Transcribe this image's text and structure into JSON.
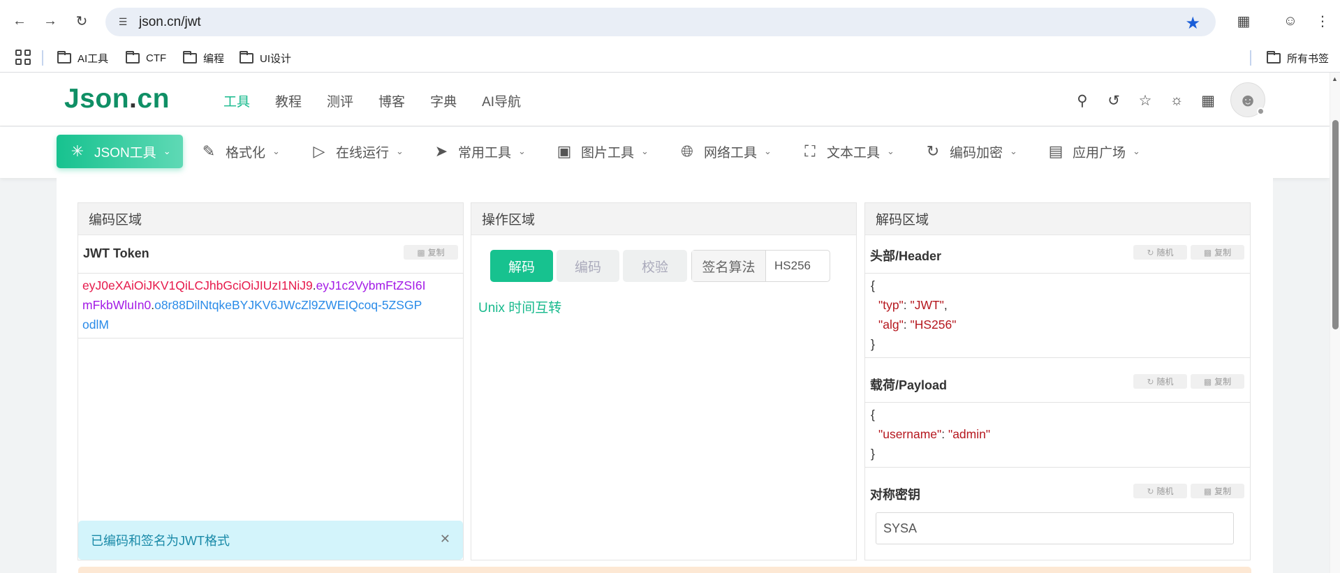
{
  "browser": {
    "url": "json.cn/jwt",
    "bookmarks": [
      "AI工具",
      "CTF",
      "编程",
      "UI设计"
    ],
    "all_bookmarks": "所有书签"
  },
  "site": {
    "logo_main": "Json",
    "logo_dot": ".",
    "logo_tld": "cn",
    "nav": [
      "工具",
      "教程",
      "测评",
      "博客",
      "字典",
      "AI导航"
    ],
    "active_nav": "工具"
  },
  "tools": [
    {
      "label": "JSON工具",
      "icon": "sparkle-icon"
    },
    {
      "label": "格式化",
      "icon": "brush-icon"
    },
    {
      "label": "在线运行",
      "icon": "play-icon"
    },
    {
      "label": "常用工具",
      "icon": "rocket-icon"
    },
    {
      "label": "图片工具",
      "icon": "image-icon"
    },
    {
      "label": "网络工具",
      "icon": "globe-icon"
    },
    {
      "label": "文本工具",
      "icon": "frame-icon"
    },
    {
      "label": "编码加密",
      "icon": "encode-icon"
    },
    {
      "label": "应用广场",
      "icon": "bag-icon"
    }
  ],
  "encode": {
    "title": "编码区域",
    "token_label": "JWT Token",
    "copy": "复制",
    "token_part1": "eyJ0eXAiOiJKV1QiLCJhbGciOiJIUzI1NiJ9",
    "token_part2": "eyJ1c2VybmFtZSI6ImFkbWluIn0",
    "token_part3": "o8r88DilNtqkeBYJKV6JWcZl9ZWEIQcoq-5ZSGPodlM",
    "token_line1": "eyJ0eXAiOiJKV1QiLCJhbGciOiJIUzI1NiJ9.eyJ1c2VybmFtZSI6I",
    "token_line2": "mFkbWluIn0.o8r88DilNtqkeBYJKV6JWcZl9ZWEIQcoq-5ZSGP",
    "token_line3": "odlM",
    "alert": "已编码和签名为JWT格式"
  },
  "operate": {
    "title": "操作区域",
    "decode": "解码",
    "encode": "编码",
    "verify": "校验",
    "algo_label": "签名算法",
    "algo_value": "HS256",
    "unix_link": "Unix 时间互转"
  },
  "decode": {
    "title": "解码区域",
    "header_label": "头部/Header",
    "payload_label": "载荷/Payload",
    "secret_label": "对称密钥",
    "random": "随机",
    "copy": "复制",
    "header_json": {
      "typ": "JWT",
      "alg": "HS256"
    },
    "header_lines": [
      "{",
      "\"typ\": \"JWT\",",
      "\"alg\": \"HS256\"",
      "}"
    ],
    "payload_lines": [
      "{",
      "\"username\": \"admin\"",
      "}"
    ],
    "secret_value": "SYSA"
  },
  "colors": {
    "accent": "#17c28f",
    "jwt_header": "#e6194b",
    "jwt_payload": "#a31ae6",
    "jwt_signature": "#2a8be8",
    "json_value": "#b5171e"
  }
}
